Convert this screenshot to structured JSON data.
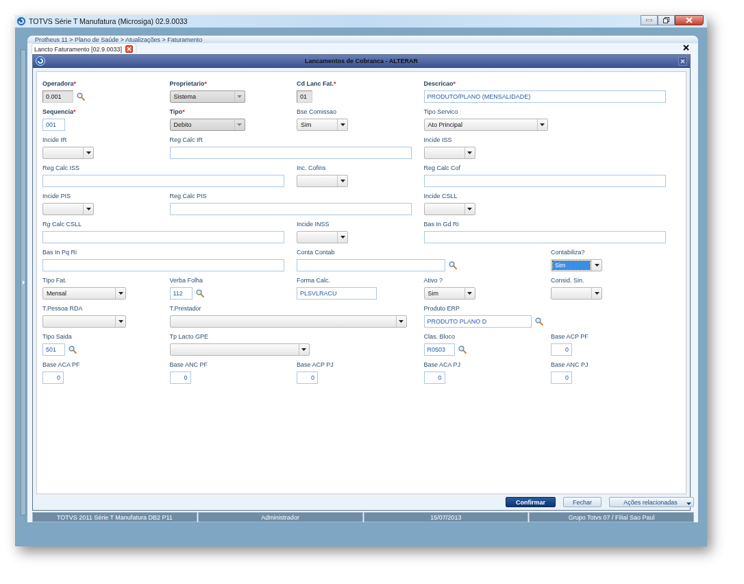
{
  "window": {
    "title": "TOTVS Série T Manufatura (Microsiga) 02.9.0033"
  },
  "breadcrumb": "Protheus 11 > Plano de Saúde > Atualizações > Faturamento",
  "tabs": [
    {
      "label": "Lancto Faturamento [02.9.0033]",
      "selected": true
    }
  ],
  "dialog": {
    "title": "Lancamentos de Cobranca - ALTERAR"
  },
  "required_mark": "*",
  "form": {
    "rows": [
      [
        {
          "label": "Operadora",
          "required": true,
          "kind": "text",
          "value": "0.001",
          "disabled": true,
          "lookup": true
        },
        {
          "label": "Proprietario",
          "required": true,
          "kind": "combo",
          "value": "Sistema",
          "disabled": true,
          "highlighted": false
        },
        {
          "label": "Cd Lanc Fat.",
          "required": true,
          "kind": "text",
          "value": "01",
          "disabled": true,
          "lookup": false
        },
        {
          "label": "Descricao",
          "required": true,
          "kind": "text",
          "value": "PRODUTO/PLANO (MENSALIDADE)",
          "disabled": false,
          "lookup": false
        },
        ""
      ],
      [
        {
          "label": "Sequencia",
          "required": true,
          "kind": "text",
          "value": "001",
          "disabled": false,
          "lookup": false
        },
        {
          "label": "Tipo",
          "required": true,
          "kind": "combo",
          "value": "Debito",
          "disabled": true,
          "highlighted": false
        },
        {
          "label": "Bse Comissao",
          "required": false,
          "kind": "combo",
          "value": "Sim",
          "disabled": false,
          "highlighted": false
        },
        {
          "label": "Tipo Servico",
          "required": false,
          "kind": "combo",
          "value": "Ato Principal",
          "disabled": false,
          "highlighted": false
        },
        ""
      ],
      [
        {
          "label": "Incide IR",
          "required": false,
          "kind": "combo",
          "disabled": false,
          "highlighted": false
        },
        {
          "label": "Reg Calc IR",
          "required": false,
          "kind": "text",
          "disabled": false,
          "lookup": false
        },
        "",
        {
          "label": "Incide ISS",
          "required": false,
          "kind": "combo",
          "disabled": false,
          "highlighted": false
        },
        ""
      ],
      [
        {
          "label": "Reg Calc ISS",
          "required": false,
          "kind": "text",
          "disabled": false,
          "lookup": false
        },
        "",
        {
          "label": "Inc. Cofins",
          "required": false,
          "kind": "combo",
          "disabled": false,
          "highlighted": false
        },
        {
          "label": "Reg Calc Cof",
          "required": false,
          "kind": "text",
          "disabled": false,
          "lookup": false
        },
        ""
      ],
      [
        {
          "label": "Incide PIS",
          "required": false,
          "kind": "combo",
          "disabled": false,
          "highlighted": false
        },
        {
          "label": "Reg Calc PIS",
          "required": false,
          "kind": "text",
          "disabled": false,
          "lookup": false
        },
        "",
        {
          "label": "Incide CSLL",
          "required": false,
          "kind": "combo",
          "disabled": false,
          "highlighted": false
        },
        ""
      ],
      [
        {
          "label": "Rg Calc CSLL",
          "required": false,
          "kind": "text",
          "disabled": false,
          "lookup": false
        },
        "",
        {
          "label": "Incide INSS",
          "required": false,
          "kind": "combo",
          "disabled": false,
          "highlighted": false
        },
        {
          "label": "Bas In Gd Ri",
          "required": false,
          "kind": "text",
          "disabled": false,
          "lookup": false
        },
        ""
      ],
      [
        {
          "label": "Bas In Pq Ri",
          "required": false,
          "kind": "text",
          "disabled": false,
          "lookup": false
        },
        "",
        {
          "label": "Conta Contab",
          "required": false,
          "kind": "text",
          "disabled": false,
          "lookup": true
        },
        "",
        {
          "label": "Contabiliza?",
          "required": false,
          "kind": "combo",
          "value": "Sim",
          "disabled": false,
          "highlighted": true
        }
      ],
      [
        {
          "label": "Tipo Fat.",
          "required": false,
          "kind": "combo",
          "value": "Mensal",
          "disabled": false,
          "highlighted": false
        },
        {
          "label": "Verba Folha",
          "required": false,
          "kind": "text",
          "value": "112",
          "disabled": false,
          "lookup": true
        },
        {
          "label": "Forma Calc.",
          "required": false,
          "kind": "text",
          "value": "PLSVLRACU",
          "disabled": false,
          "lookup": false
        },
        {
          "label": "Ativo ?",
          "required": false,
          "kind": "combo",
          "value": "Sim",
          "disabled": false,
          "highlighted": false
        },
        {
          "label": "Consid. Sin.",
          "required": false,
          "kind": "combo",
          "disabled": false,
          "highlighted": false
        }
      ],
      [
        {
          "label": "T.Pessoa RDA",
          "required": false,
          "kind": "combo",
          "disabled": false,
          "highlighted": false
        },
        {
          "label": "T.Prestador",
          "required": false,
          "kind": "combo",
          "disabled": false,
          "highlighted": false
        },
        "",
        {
          "label": "Produto ERP",
          "required": false,
          "kind": "text",
          "value": "PRODUTO PLANO D",
          "disabled": false,
          "lookup": true
        },
        ""
      ],
      [
        {
          "label": "Tipo Saida",
          "required": false,
          "kind": "text",
          "value": "501",
          "disabled": false,
          "lookup": true
        },
        {
          "label": "Tp Lacto GPE",
          "required": false,
          "kind": "combo",
          "disabled": false,
          "highlighted": false
        },
        "",
        {
          "label": "Clas. Bloco",
          "required": false,
          "kind": "text",
          "value": "R0503",
          "disabled": false,
          "lookup": true
        },
        {
          "label": "Base ACP PF",
          "required": false,
          "kind": "number",
          "value": "0",
          "disabled": false,
          "lookup": false
        }
      ],
      [
        {
          "label": "Base ACA PF",
          "required": false,
          "kind": "number",
          "value": "0",
          "disabled": false,
          "lookup": false
        },
        {
          "label": "Base ANC PF",
          "required": false,
          "kind": "number",
          "value": "0",
          "disabled": false,
          "lookup": false
        },
        {
          "label": "Base ACP PJ",
          "required": false,
          "kind": "number",
          "value": "0",
          "disabled": false,
          "lookup": false
        },
        {
          "label": "Base ACA PJ",
          "required": false,
          "kind": "number",
          "value": "0",
          "disabled": false,
          "lookup": false
        },
        {
          "label": "Base ANC PJ",
          "required": false,
          "kind": "number",
          "value": "0",
          "disabled": false,
          "lookup": false
        }
      ]
    ]
  },
  "buttons": [
    {
      "label": "Confirmar",
      "kind": "primary"
    },
    {
      "label": "Fechar",
      "kind": "plain"
    },
    {
      "label": "Ações relacionadas",
      "kind": "menu"
    }
  ],
  "status_bar": [
    "TOTVS 2011 Série T Manufatura DB2 P11",
    "Administrador",
    "15/07/2013",
    "Grupo Totvs 07 / Filial Sao Paul"
  ]
}
